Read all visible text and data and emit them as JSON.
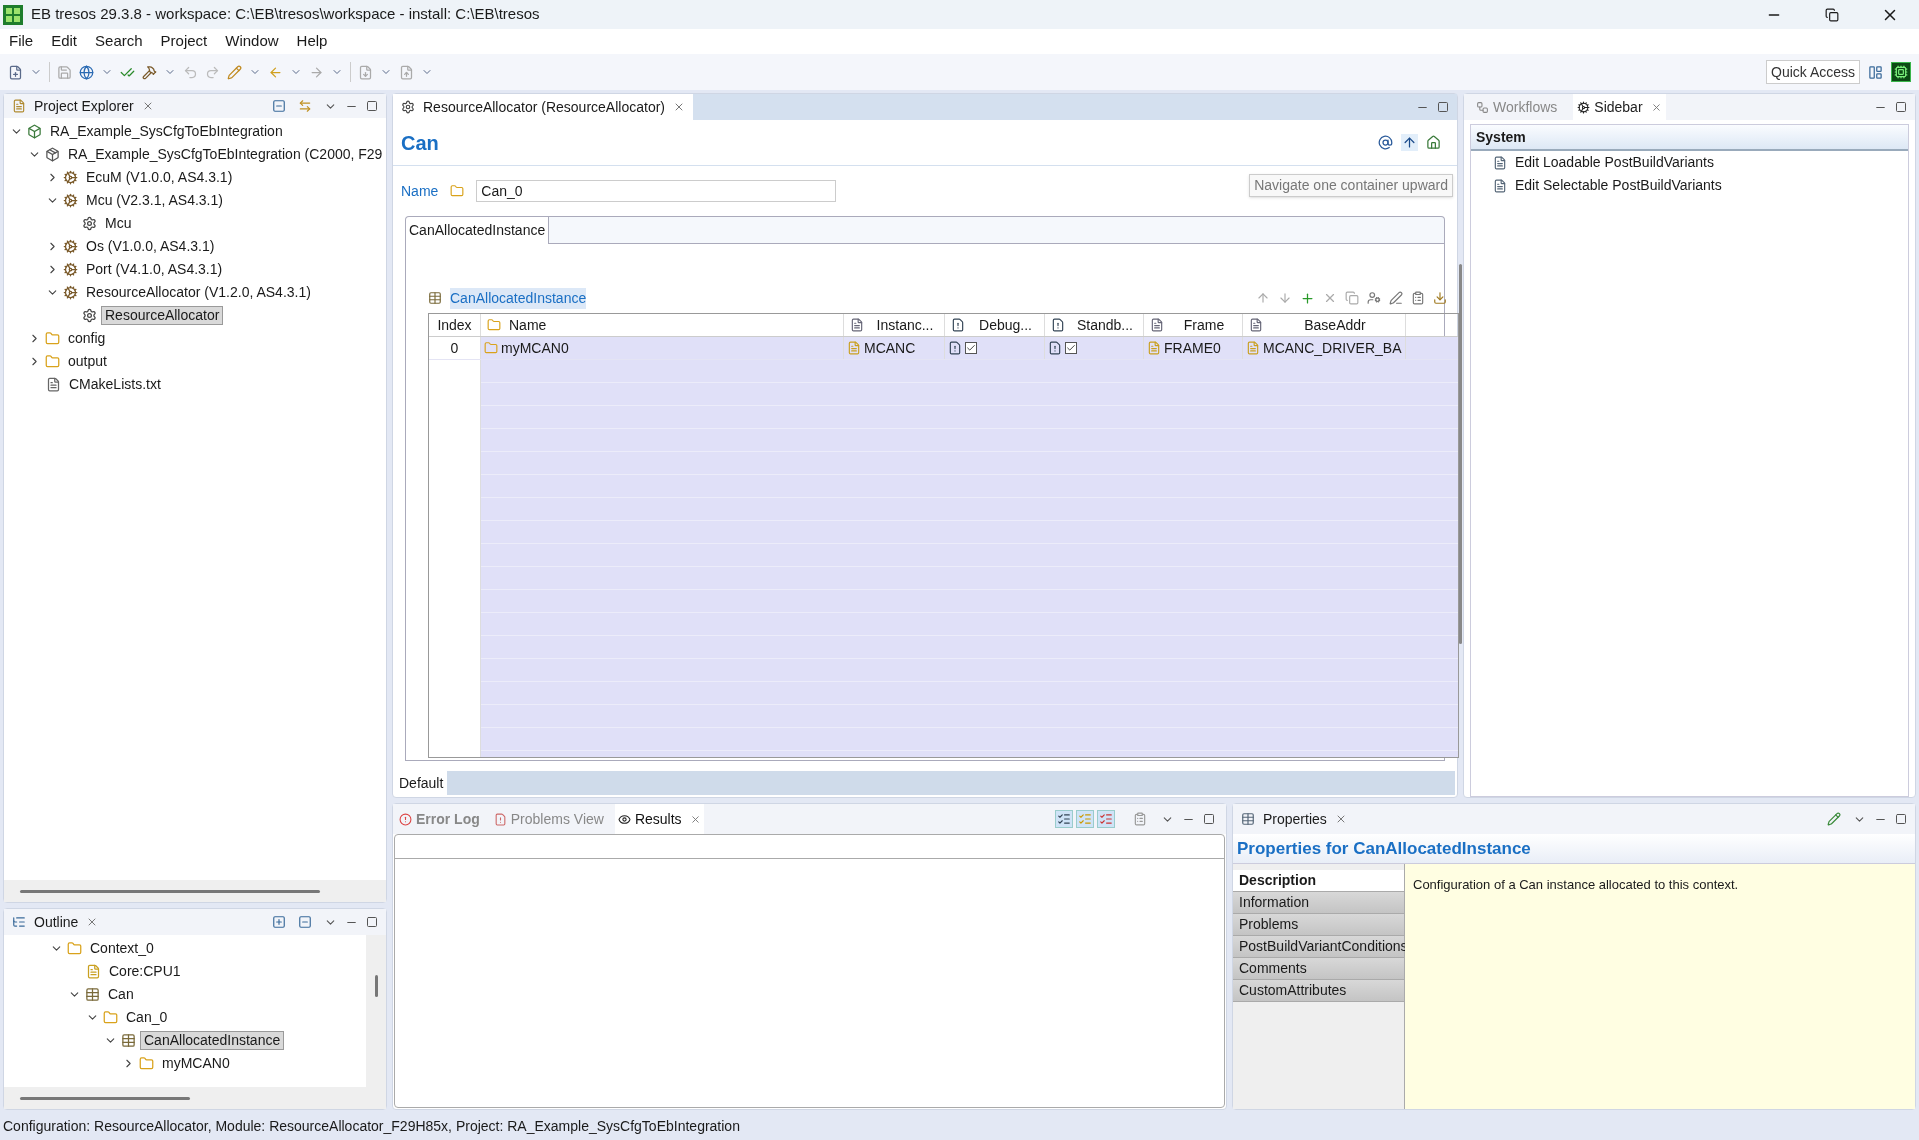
{
  "window": {
    "title": "EB tresos 29.3.8 - workspace: C:\\EB\\tresos\\workspace - install: C:\\EB\\tresos"
  },
  "menu": [
    "File",
    "Edit",
    "Search",
    "Project",
    "Window",
    "Help"
  ],
  "quick_access": {
    "placeholder": "Quick Access"
  },
  "project_explorer": {
    "title": "Project Explorer",
    "items": [
      {
        "label": "RA_Example_SysCfgToEbIntegration",
        "kind": "project",
        "expanded": true,
        "selected": false,
        "children": [
          {
            "label": "RA_Example_SysCfgToEbIntegration (C2000, F29",
            "kind": "config",
            "expanded": true,
            "selected": false,
            "children": [
              {
                "label": "EcuM (V1.0.0, AS4.3.1)",
                "kind": "module",
                "expanded": false,
                "selected": false
              },
              {
                "label": "Mcu (V2.3.1, AS4.3.1)",
                "kind": "module",
                "expanded": true,
                "selected": false,
                "children": [
                  {
                    "label": "Mcu",
                    "kind": "instance",
                    "selected": false
                  }
                ]
              },
              {
                "label": "Os (V1.0.0, AS4.3.1)",
                "kind": "module",
                "expanded": false,
                "selected": false
              },
              {
                "label": "Port (V4.1.0, AS4.3.1)",
                "kind": "module",
                "expanded": false,
                "selected": false
              },
              {
                "label": "ResourceAllocator (V1.2.0, AS4.3.1)",
                "kind": "module",
                "expanded": true,
                "selected": false,
                "children": [
                  {
                    "label": "ResourceAllocator",
                    "kind": "instance",
                    "selected": true
                  }
                ]
              }
            ]
          },
          {
            "label": "config",
            "kind": "folder",
            "expanded": false,
            "selected": false
          },
          {
            "label": "output",
            "kind": "folder",
            "expanded": false,
            "selected": false
          },
          {
            "label": "CMakeLists.txt",
            "kind": "file",
            "selected": false
          }
        ]
      }
    ]
  },
  "outline": {
    "title": "Outline",
    "items": [
      {
        "label": "Context_0",
        "kind": "folder",
        "expanded": true,
        "selected": false,
        "children": [
          {
            "label": "Core:CPU1",
            "kind": "param",
            "selected": false
          },
          {
            "label": "Can",
            "kind": "table",
            "expanded": true,
            "selected": false,
            "children": [
              {
                "label": "Can_0",
                "kind": "folder",
                "expanded": true,
                "selected": false,
                "children": [
                  {
                    "label": "CanAllocatedInstance",
                    "kind": "table",
                    "expanded": true,
                    "selected": true,
                    "children": [
                      {
                        "label": "myMCAN0",
                        "kind": "folder",
                        "expanded": false,
                        "selected": false
                      }
                    ]
                  }
                ]
              }
            ]
          }
        ]
      }
    ]
  },
  "editor": {
    "tab": "ResourceAllocator (ResourceAllocator)",
    "heading": "Can",
    "name_label": "Name",
    "name_value": "Can_0",
    "tooltip": "Navigate one container upward",
    "inner_tab": "CanAllocatedInstance",
    "table_title": "CanAllocatedInstance",
    "columns": [
      {
        "label": "Index",
        "kind": "plain"
      },
      {
        "label": "Name",
        "kind": "folder"
      },
      {
        "label": "Instanc...",
        "kind": "file"
      },
      {
        "label": "Debug...",
        "kind": "bool"
      },
      {
        "label": "Standb...",
        "kind": "bool"
      },
      {
        "label": "Frame",
        "kind": "file"
      },
      {
        "label": "BaseAddr",
        "kind": "file"
      }
    ],
    "rows": [
      {
        "selected": true,
        "cells": [
          {
            "kind": "text",
            "text": "0"
          },
          {
            "kind": "folder",
            "text": "myMCAN0"
          },
          {
            "kind": "param",
            "text": "MCANC"
          },
          {
            "kind": "check",
            "checked": true
          },
          {
            "kind": "check",
            "checked": true
          },
          {
            "kind": "param",
            "text": "FRAME0"
          },
          {
            "kind": "param",
            "text": "MCANC_DRIVER_BA"
          }
        ]
      }
    ],
    "bottom_tab": "Default"
  },
  "sidebar": {
    "tabs": [
      {
        "label": "Workflows",
        "selected": false
      },
      {
        "label": "Sidebar",
        "selected": true
      }
    ],
    "section": "System",
    "items": [
      "Edit Loadable PostBuildVariants",
      "Edit Selectable PostBuildVariants"
    ]
  },
  "results": {
    "tabs": [
      {
        "label": "Error Log",
        "selected": false,
        "bold": true
      },
      {
        "label": "Problems View",
        "selected": false,
        "bold": false
      },
      {
        "label": "Results",
        "selected": true,
        "bold": false
      }
    ]
  },
  "properties": {
    "title": "Properties",
    "heading": "Properties for CanAllocatedInstance",
    "tabs": [
      {
        "label": "Description",
        "selected": true
      },
      {
        "label": "Information",
        "selected": false
      },
      {
        "label": "Problems",
        "selected": false
      },
      {
        "label": "PostBuildVariantConditions",
        "selected": false
      },
      {
        "label": "Comments",
        "selected": false
      },
      {
        "label": "CustomAttributes",
        "selected": false
      }
    ],
    "description": "Configuration of a Can instance allocated to this context."
  },
  "status_bar": "Configuration: ResourceAllocator, Module: ResourceAllocator_F29H85x, Project: RA_Example_SysCfgToEbIntegration"
}
